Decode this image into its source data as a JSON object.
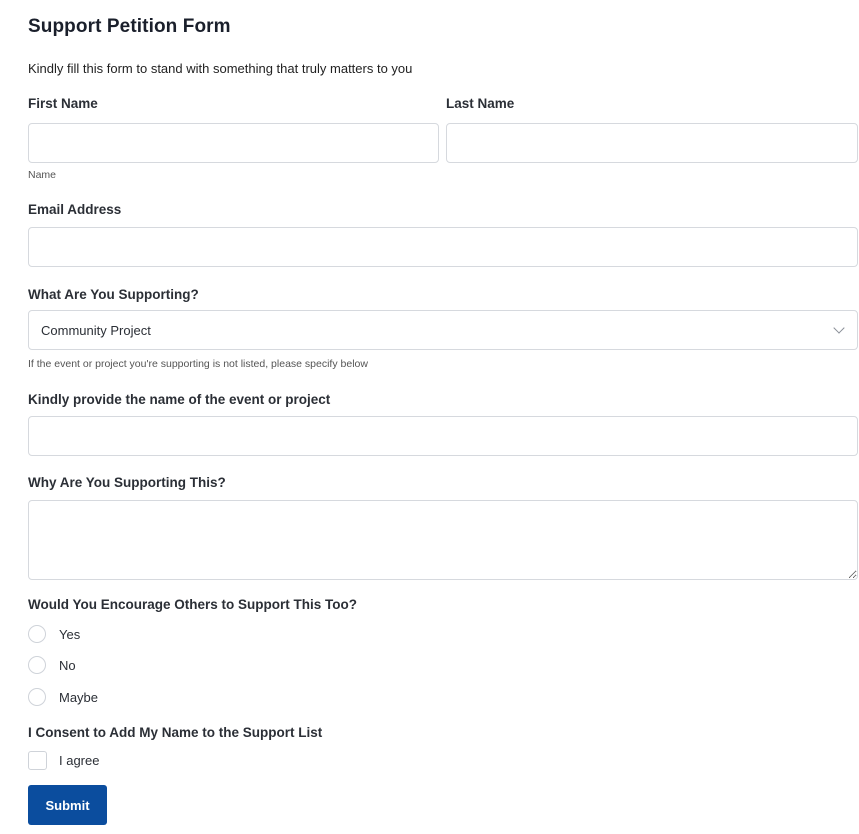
{
  "form": {
    "title": "Support Petition Form",
    "subtitle": "Kindly fill this form to stand with something that truly matters to you",
    "first_name": {
      "label": "First Name",
      "value": ""
    },
    "last_name": {
      "label": "Last Name",
      "value": ""
    },
    "name_hint": "Name",
    "email": {
      "label": "Email Address",
      "value": ""
    },
    "supporting": {
      "label": "What Are You Supporting?",
      "selected": "Community Project",
      "hint": "If the event or project you're supporting is not listed, please specify below"
    },
    "event_name": {
      "label": "Kindly provide the name of the event or project",
      "value": ""
    },
    "why": {
      "label": "Why Are You Supporting This?",
      "value": ""
    },
    "encourage": {
      "label": "Would You Encourage Others to Support This Too?",
      "options": [
        "Yes",
        "No",
        "Maybe"
      ]
    },
    "consent": {
      "label": "I Consent to Add My Name to the Support List",
      "checkbox_label": "I agree"
    },
    "submit_label": "Submit",
    "colors": {
      "accent": "#0b4d9e",
      "border": "#d6d9de"
    }
  }
}
